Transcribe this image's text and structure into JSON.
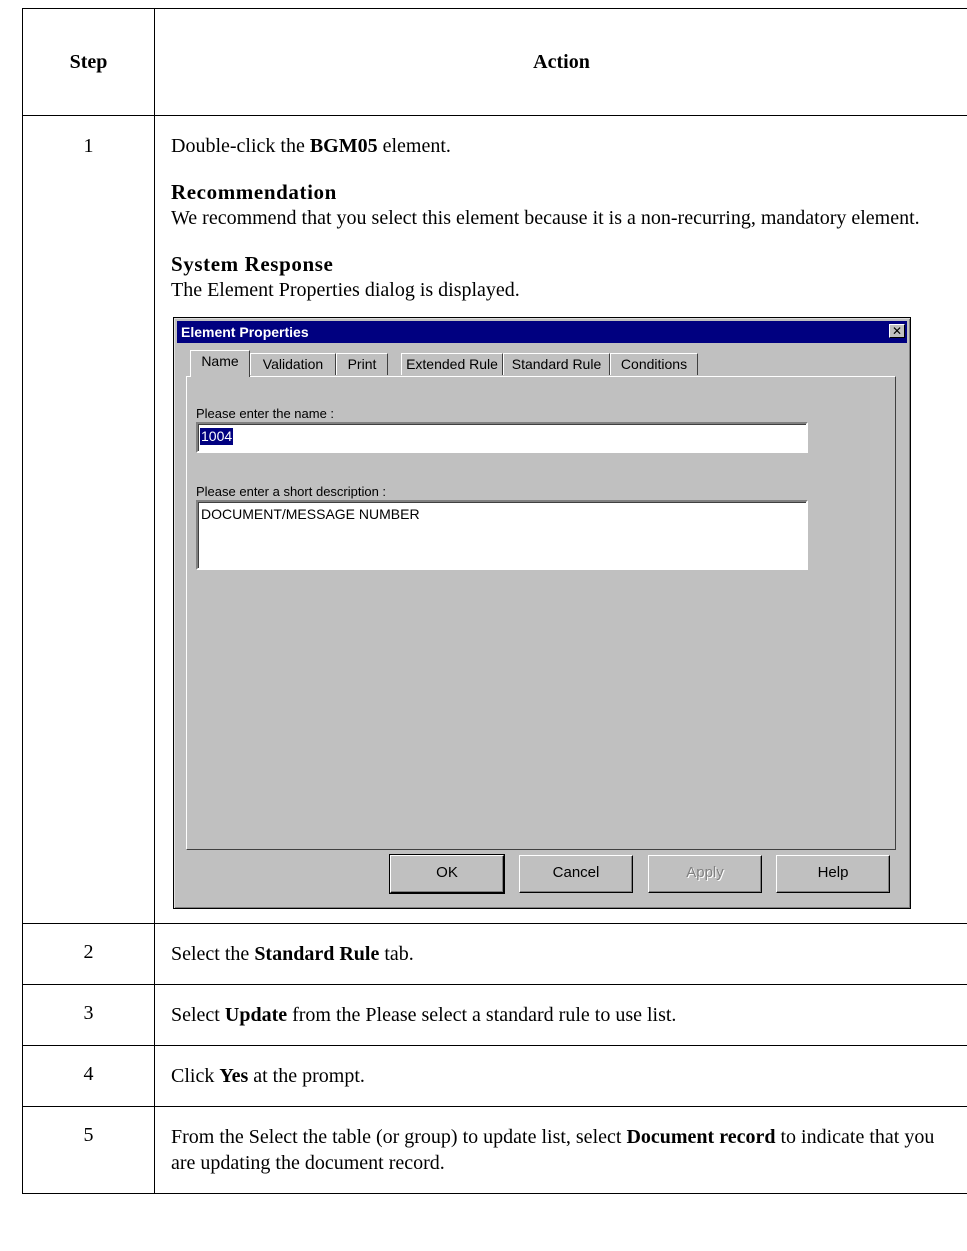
{
  "table": {
    "header": {
      "step": "Step",
      "action": "Action"
    },
    "rows": [
      {
        "step": "1",
        "text_pre": "Double-click the ",
        "text_bold": "BGM05",
        "text_post": " element.",
        "recommendation_heading": "Recommendation",
        "recommendation_text": "We recommend that you select this element because it is a non-recurring, mandatory element.",
        "response_heading": "System Response",
        "response_text": "The Element Properties dialog is displayed."
      },
      {
        "step": "2",
        "text_pre": "Select the ",
        "text_bold": "Standard Rule",
        "text_post": " tab."
      },
      {
        "step": "3",
        "text_pre": "Select ",
        "text_bold": "Update",
        "text_post": " from the Please select a standard rule to use list."
      },
      {
        "step": "4",
        "text_pre": "Click ",
        "text_bold": "Yes",
        "text_post": " at the prompt."
      },
      {
        "step": "5",
        "text_pre": "From the Select the table (or group) to update list, select ",
        "text_bold": "Document record",
        "text_post": " to indicate that you are updating the document record."
      }
    ]
  },
  "dialog": {
    "title": "Element Properties",
    "close_glyph": "✕",
    "tabs": [
      "Name",
      "Validation",
      "Print",
      "Extended Rule",
      "Standard Rule",
      "Conditions"
    ],
    "active_tab": "Name",
    "name_label": "Please enter the name :",
    "name_value": "1004",
    "desc_label": "Please enter a short description :",
    "desc_value": "DOCUMENT/MESSAGE NUMBER",
    "buttons": {
      "ok": "OK",
      "cancel": "Cancel",
      "apply": "Apply",
      "help": "Help"
    },
    "colors": {
      "titlebar": "#000080",
      "face": "#c0c0c0"
    }
  }
}
